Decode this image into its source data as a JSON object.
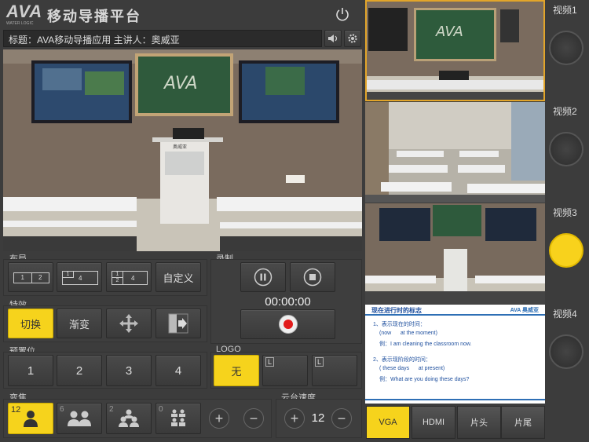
{
  "header": {
    "logo_text": "AVA",
    "logo_sub": "WATER LOGIC",
    "app_title": "移动导播平台",
    "subject_line": "标题：AVA移动导播应用 主讲人：奥威亚"
  },
  "sections": {
    "layout": "布局",
    "record": "录制",
    "effects": "特效",
    "presets": "预置位",
    "logo": "LOGO",
    "zoom": "变焦",
    "ptz_speed": "云台速度"
  },
  "layout_buttons": {
    "a1": "1",
    "a2": "2",
    "b1": "1",
    "b2": "4",
    "c1": "1",
    "c2": "2",
    "c3": "4",
    "custom": "自定义"
  },
  "record": {
    "timer": "00:00:00"
  },
  "effects": {
    "cut": "切换",
    "fade": "渐变"
  },
  "presets": [
    "1",
    "2",
    "3",
    "4"
  ],
  "logo": {
    "none": "无",
    "l1": "L",
    "l2": "L"
  },
  "zoom": {
    "count1": "12",
    "count2": "6",
    "count3": "2",
    "count4": "0"
  },
  "ptz": {
    "plus": "+",
    "minus": "−",
    "speed": "12",
    "zplus": "+",
    "zminus": "−"
  },
  "videos": [
    "视频1",
    "视频2",
    "视频3",
    "视频4"
  ],
  "slide": {
    "title": "现在进行时的标志",
    "brand": "AVA 奥威亚",
    "line1": "1、表示现在的时间：",
    "line2": "(now      at the moment)",
    "line3": "例：I am cleaning the classroom now.",
    "line4": "2、表示现阶段的时间：",
    "line5": "( these days      at present)",
    "line6": "例：What are you doing these days?"
  },
  "board_text": "AVA",
  "podium_text": "奥威亚",
  "tabs": [
    "VGA",
    "HDMI",
    "片头",
    "片尾"
  ],
  "colors": {
    "accent": "#f6d31c",
    "record": "#e21b1b"
  }
}
